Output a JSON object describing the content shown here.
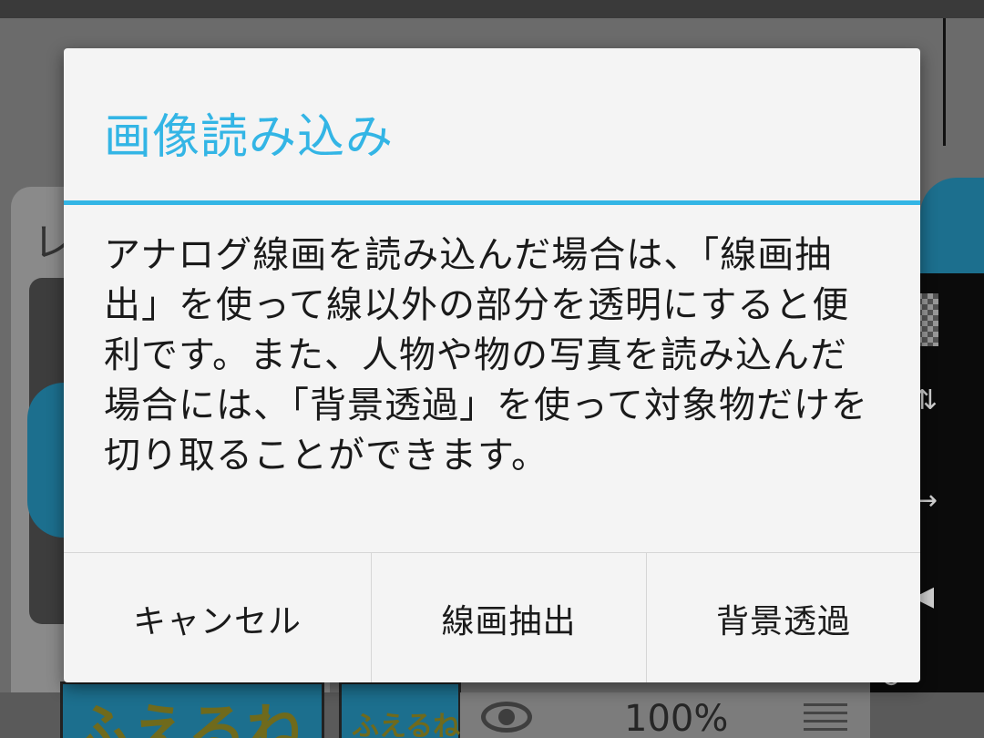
{
  "dialog": {
    "title": "画像読み込み",
    "message": "アナログ線画を読み込んだ場合は、「線画抽出」を使って線以外の部分を透明にすると便利です。また、人物や物の写真を読み込んだ場合には、「背景透過」を使って対象物だけを切り取ることができます。",
    "buttons": {
      "cancel": "キャンセル",
      "line_extract": "線画抽出",
      "background_transparent": "背景透過"
    }
  },
  "background_app": {
    "panel_letter": "レ",
    "thumbnail_text_1": "ふえるね",
    "thumbnail_text_2": "ふえるね",
    "layer_opacity": "100%"
  },
  "colors": {
    "accent": "#33b5e5",
    "dialog_background": "#f4f4f4",
    "scrim": "#6b6b6b"
  }
}
